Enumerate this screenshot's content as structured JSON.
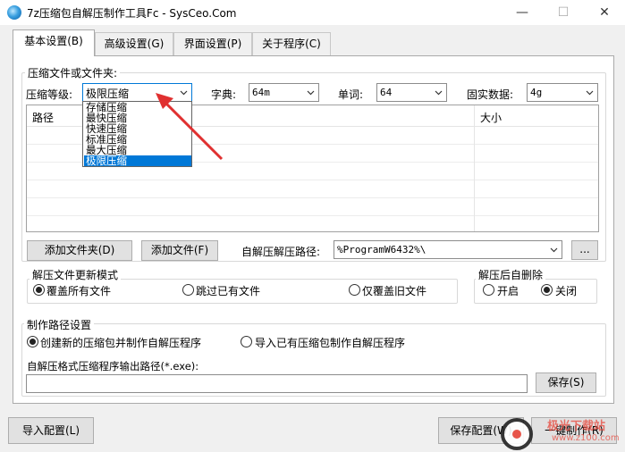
{
  "window": {
    "title": "7z压缩包自解压制作工具Fc - SysCeo.Com",
    "minimize_glyph": "—",
    "maximize_glyph": "☐",
    "close_glyph": "✕"
  },
  "tabs": [
    {
      "label": "基本设置(B)",
      "active": true
    },
    {
      "label": "高级设置(G)",
      "active": false
    },
    {
      "label": "界面设置(P)",
      "active": false
    },
    {
      "label": "关于程序(C)",
      "active": false
    }
  ],
  "compress": {
    "group_label": "压缩文件或文件夹:",
    "level_label": "压缩等级:",
    "level_value": "极限压缩",
    "level_options": [
      "存储压缩",
      "最快压缩",
      "快速压缩",
      "标准压缩",
      "最大压缩",
      "极限压缩"
    ],
    "dict_label": "字典:",
    "dict_value": "64m",
    "word_label": "单词:",
    "word_value": "64",
    "solid_label": "固实数据:",
    "solid_value": "4g",
    "col_path": "路径",
    "col_size": "大小"
  },
  "buttons": {
    "add_folder": "添加文件夹(D)",
    "add_file": "添加文件(F)",
    "browse": "...",
    "save": "保存(S)",
    "import_config": "导入配置(L)",
    "save_config": "保存配置(W)",
    "one_click_make": "一键制作(R)"
  },
  "extract_path": {
    "label": "自解压解压路径:",
    "value": "%ProgramW6432%\\"
  },
  "update_mode": {
    "label": "解压文件更新模式",
    "options": [
      "覆盖所有文件",
      "跳过已有文件",
      "仅覆盖旧文件"
    ],
    "selected_index": 0
  },
  "after_delete": {
    "label": "解压后自删除",
    "options": [
      "开启",
      "关闭"
    ],
    "selected_index": 1
  },
  "make_path": {
    "label": "制作路径设置",
    "options": [
      "创建新的压缩包并制作自解压程序",
      "导入已有压缩包制作自解压程序"
    ],
    "selected_index": 0,
    "output_label": "自解压格式压缩程序输出路径(*.exe):",
    "output_value": ""
  },
  "watermark": {
    "text": "极光下载站",
    "url": "www.z100.com"
  },
  "colors": {
    "accent": "#0078d7",
    "arrow": "#e03030",
    "watermark": "#e8463a"
  },
  "icons": [
    "app-icon",
    "chevron-down-icon",
    "radio-icon",
    "arrow-icon",
    "watermark-logo"
  ]
}
